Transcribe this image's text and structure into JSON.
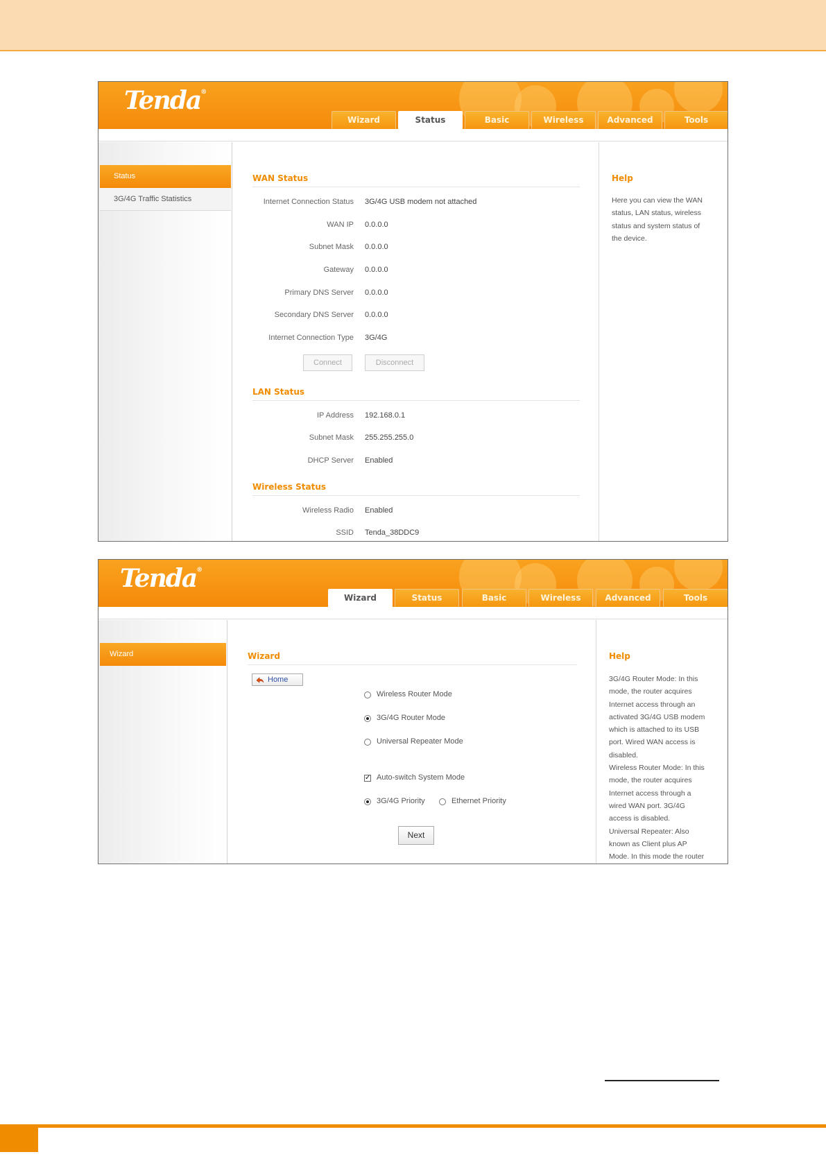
{
  "brand": {
    "logo": "Tenda",
    "accent_color": "#f08c00",
    "band_color": "#fbdcb2"
  },
  "tabs": [
    "Wizard",
    "Status",
    "Basic",
    "Wireless",
    "Advanced",
    "Tools"
  ],
  "status_screen": {
    "active_tab": "Status",
    "sidebar": {
      "items": [
        "Status",
        "3G/4G Traffic Statistics"
      ]
    },
    "wan": {
      "title": "WAN Status",
      "rows": [
        {
          "label": "Internet Connection Status",
          "value": "3G/4G USB modem not attached"
        },
        {
          "label": "WAN IP",
          "value": "0.0.0.0"
        },
        {
          "label": "Subnet Mask",
          "value": "0.0.0.0"
        },
        {
          "label": "Gateway",
          "value": "0.0.0.0"
        },
        {
          "label": "Primary DNS Server",
          "value": "0.0.0.0"
        },
        {
          "label": "Secondary DNS Server",
          "value": "0.0.0.0"
        },
        {
          "label": "Internet Connection Type",
          "value": "3G/4G"
        }
      ],
      "connect_label": "Connect",
      "disconnect_label": "Disconnect"
    },
    "lan": {
      "title": "LAN Status",
      "rows": [
        {
          "label": "IP Address",
          "value": "192.168.0.1"
        },
        {
          "label": "Subnet Mask",
          "value": "255.255.255.0"
        },
        {
          "label": "DHCP Server",
          "value": "Enabled"
        }
      ]
    },
    "wireless": {
      "title": "Wireless Status",
      "rows": [
        {
          "label": "Wireless Radio",
          "value": "Enabled"
        },
        {
          "label": "SSID",
          "value": "Tenda_38DDC9"
        }
      ]
    },
    "help": {
      "title": "Help",
      "lines": [
        "Here you can view the WAN",
        "status, LAN status, wireless",
        "status and system status of",
        "the device."
      ]
    }
  },
  "wizard_screen": {
    "active_tab": "Wizard",
    "sidebar": {
      "items": [
        "Wizard"
      ]
    },
    "title": "Wizard",
    "home_label": "Home",
    "modes": [
      {
        "label": "Wireless Router Mode",
        "selected": false
      },
      {
        "label": "3G/4G Router Mode",
        "selected": true
      },
      {
        "label": "Universal Repeater Mode",
        "selected": false
      }
    ],
    "auto_switch": {
      "label": "Auto-switch System Mode",
      "checked": true
    },
    "priority": [
      {
        "label": "3G/4G Priority",
        "selected": true
      },
      {
        "label": "Ethernet Priority",
        "selected": false
      }
    ],
    "next_label": "Next",
    "help": {
      "title": "Help",
      "lines": [
        "3G/4G Router Mode: In this",
        "mode, the router acquires",
        "Internet access through an",
        "activated 3G/4G USB modem",
        "which is attached to its USB",
        "port. Wired WAN access is",
        "disabled.",
        "Wireless Router Mode: In this",
        "mode, the router acquires",
        "Internet access through a",
        "wired WAN port. 3G/4G",
        "access is disabled.",
        "Universal Repeater: Also",
        "known as Client plus AP",
        "Mode. In this mode the router"
      ]
    }
  }
}
